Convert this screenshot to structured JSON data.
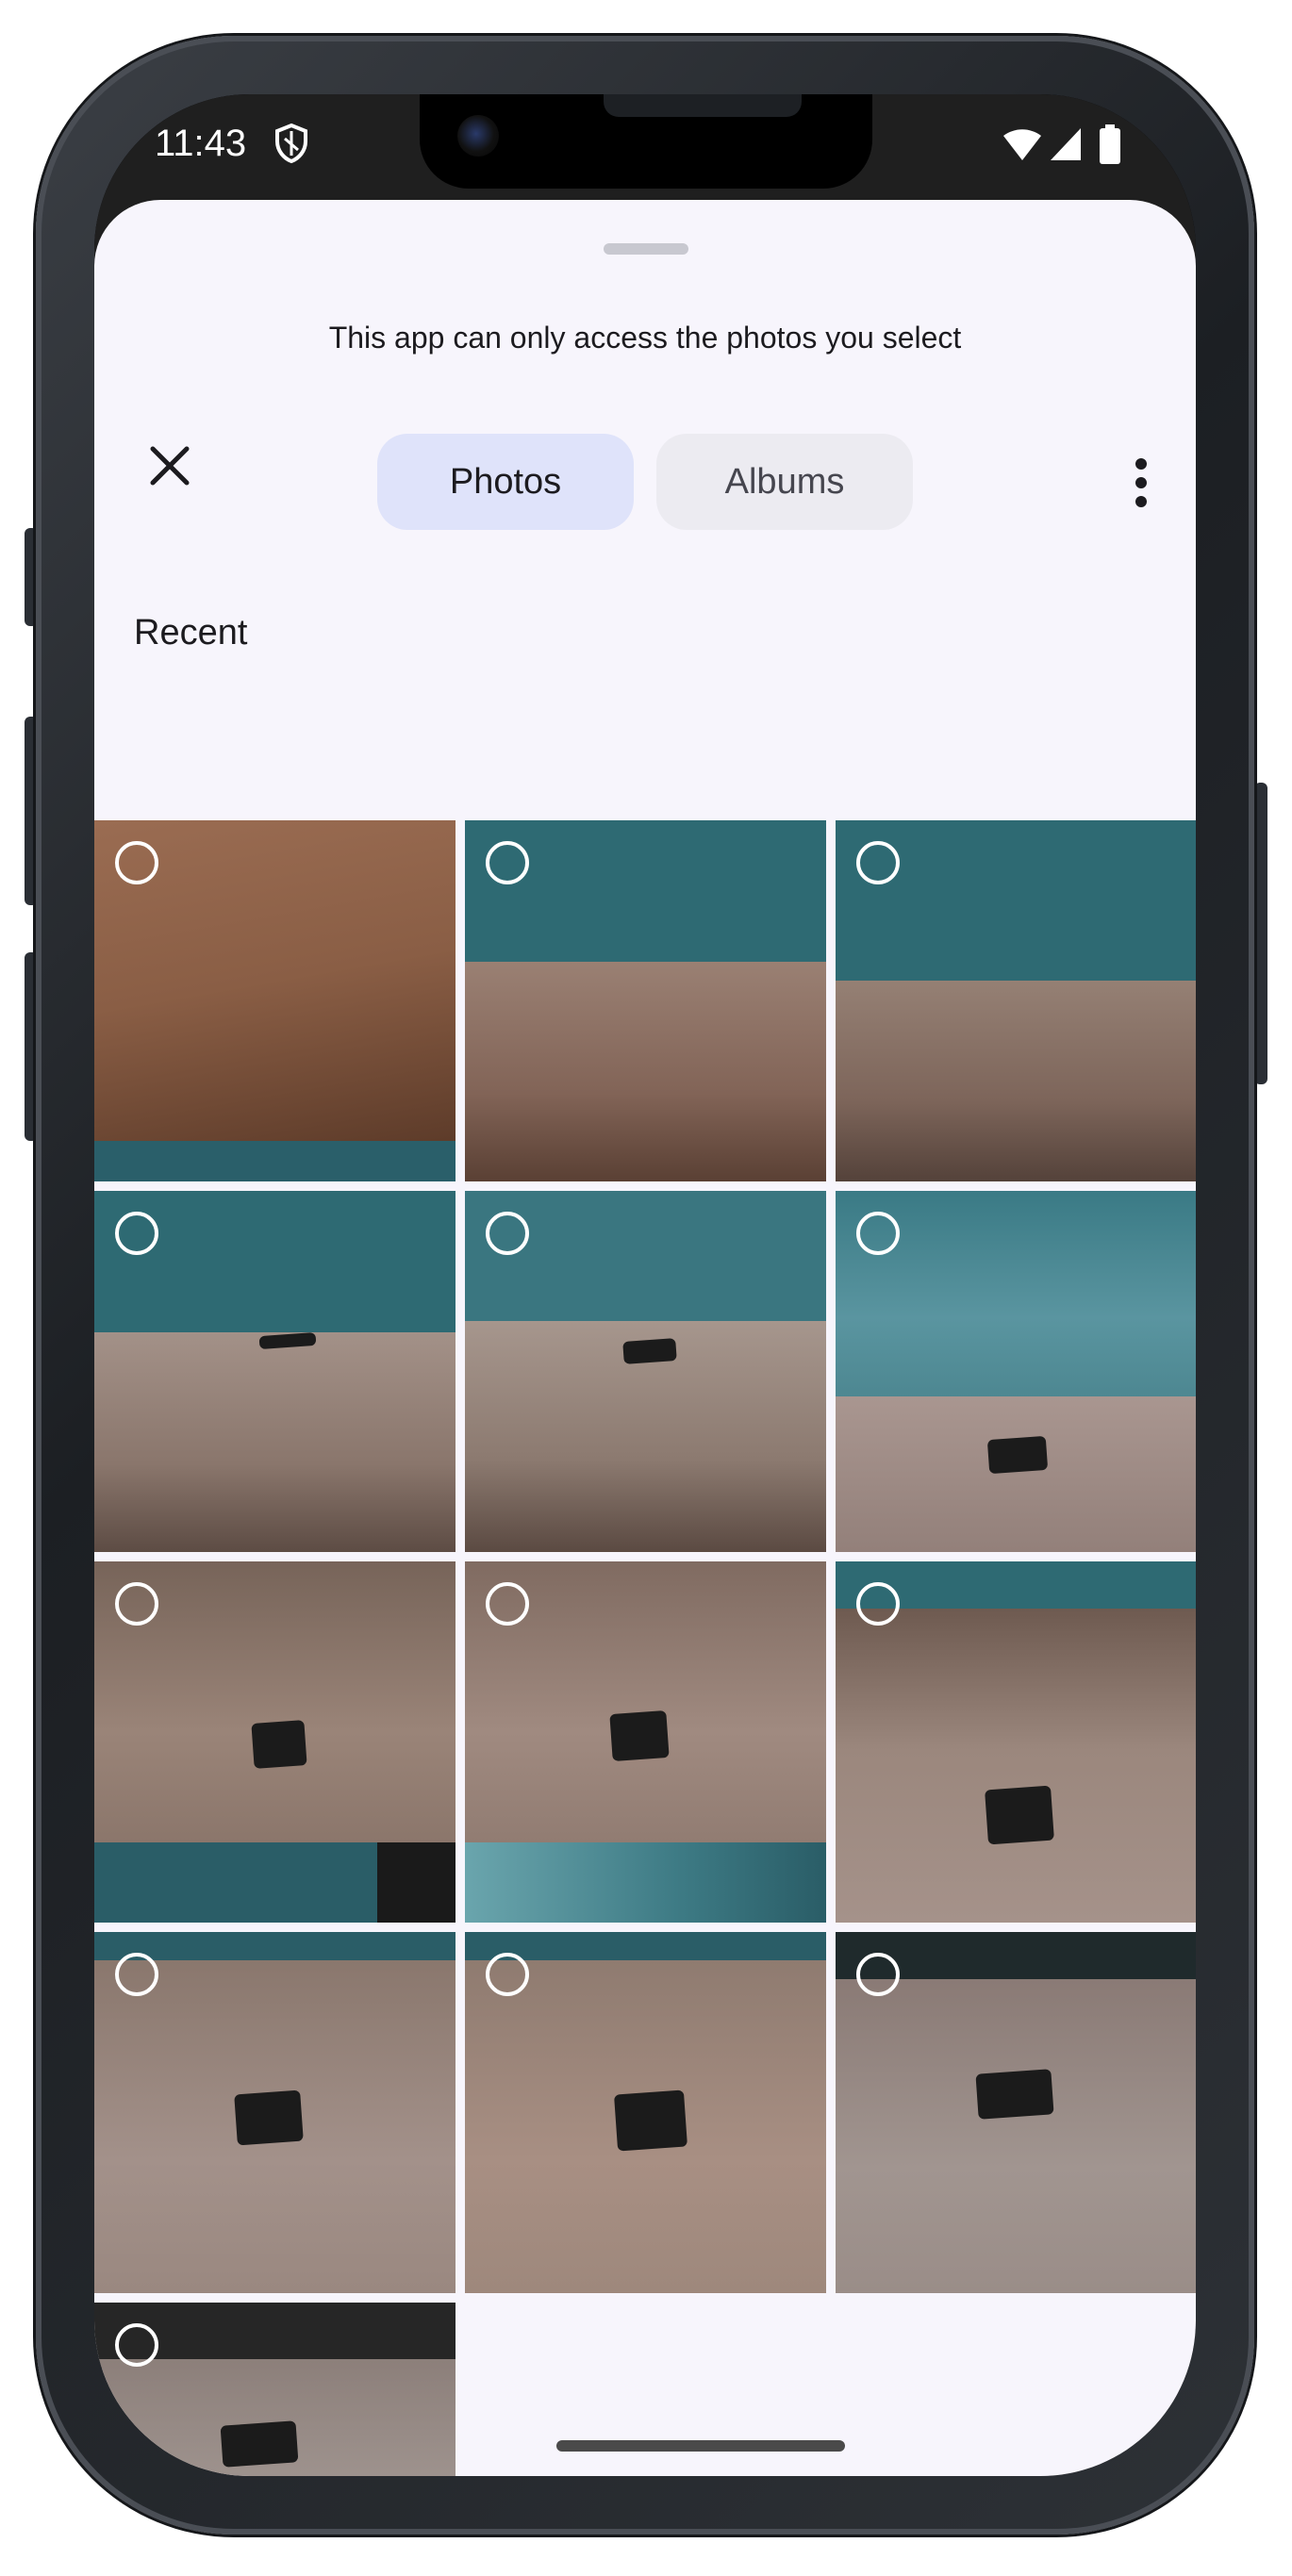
{
  "status_bar": {
    "time": "11:43",
    "icons": [
      "shield-icon",
      "wifi-icon",
      "signal-icon",
      "battery-icon"
    ]
  },
  "picker": {
    "notice": "This app can only access the photos you select",
    "close_icon": "close-icon",
    "tabs": [
      {
        "label": "Photos",
        "selected": true
      },
      {
        "label": "Albums",
        "selected": false
      }
    ],
    "more_icon": "more-vert-icon",
    "section_label": "Recent",
    "photo_count": 13,
    "photos_selected": 0
  },
  "colors": {
    "sheet_background": "#f7f5fc",
    "selected_tab": "#dfe3fa",
    "unselected_tab": "#ecebf1",
    "wall_teal": "#2e6a73"
  }
}
